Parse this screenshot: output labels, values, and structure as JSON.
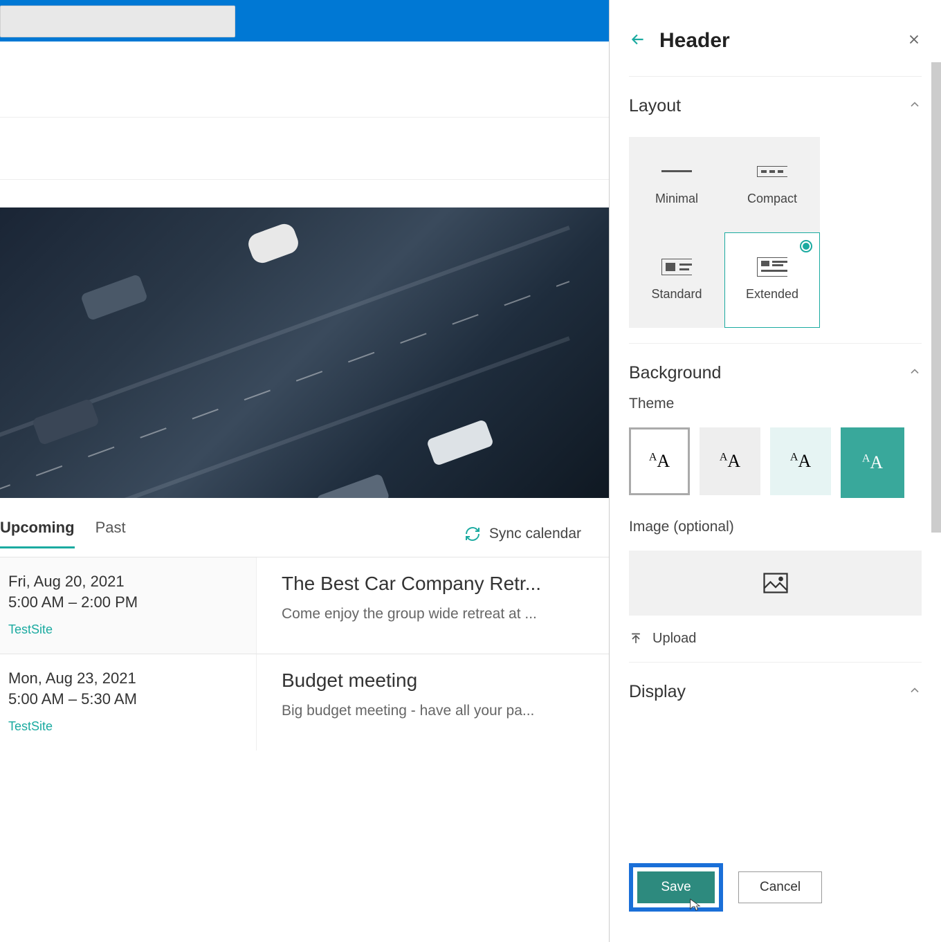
{
  "panel": {
    "title": "Header",
    "sections": {
      "layout": {
        "title": "Layout",
        "options": [
          {
            "label": "Minimal"
          },
          {
            "label": "Compact"
          },
          {
            "label": "Standard"
          },
          {
            "label": "Extended"
          }
        ],
        "selected": "Extended"
      },
      "background": {
        "title": "Background",
        "theme_label": "Theme",
        "image_label": "Image (optional)",
        "upload_label": "Upload"
      },
      "display": {
        "title": "Display"
      }
    },
    "buttons": {
      "save": "Save",
      "cancel": "Cancel"
    }
  },
  "tabs": {
    "upcoming": "Upcoming",
    "past": "Past",
    "sync": "Sync calendar"
  },
  "events": [
    {
      "date": "Fri, Aug 20, 2021",
      "time": "5:00 AM – 2:00 PM",
      "site": "TestSite",
      "title": "The Best Car Company Retr...",
      "desc": "Come enjoy the group wide retreat at ..."
    },
    {
      "date": "Mon, Aug 23, 2021",
      "time": "5:00 AM – 5:30 AM",
      "site": "TestSite",
      "title": "Budget meeting",
      "desc": "Big budget meeting - have all your pa..."
    }
  ]
}
